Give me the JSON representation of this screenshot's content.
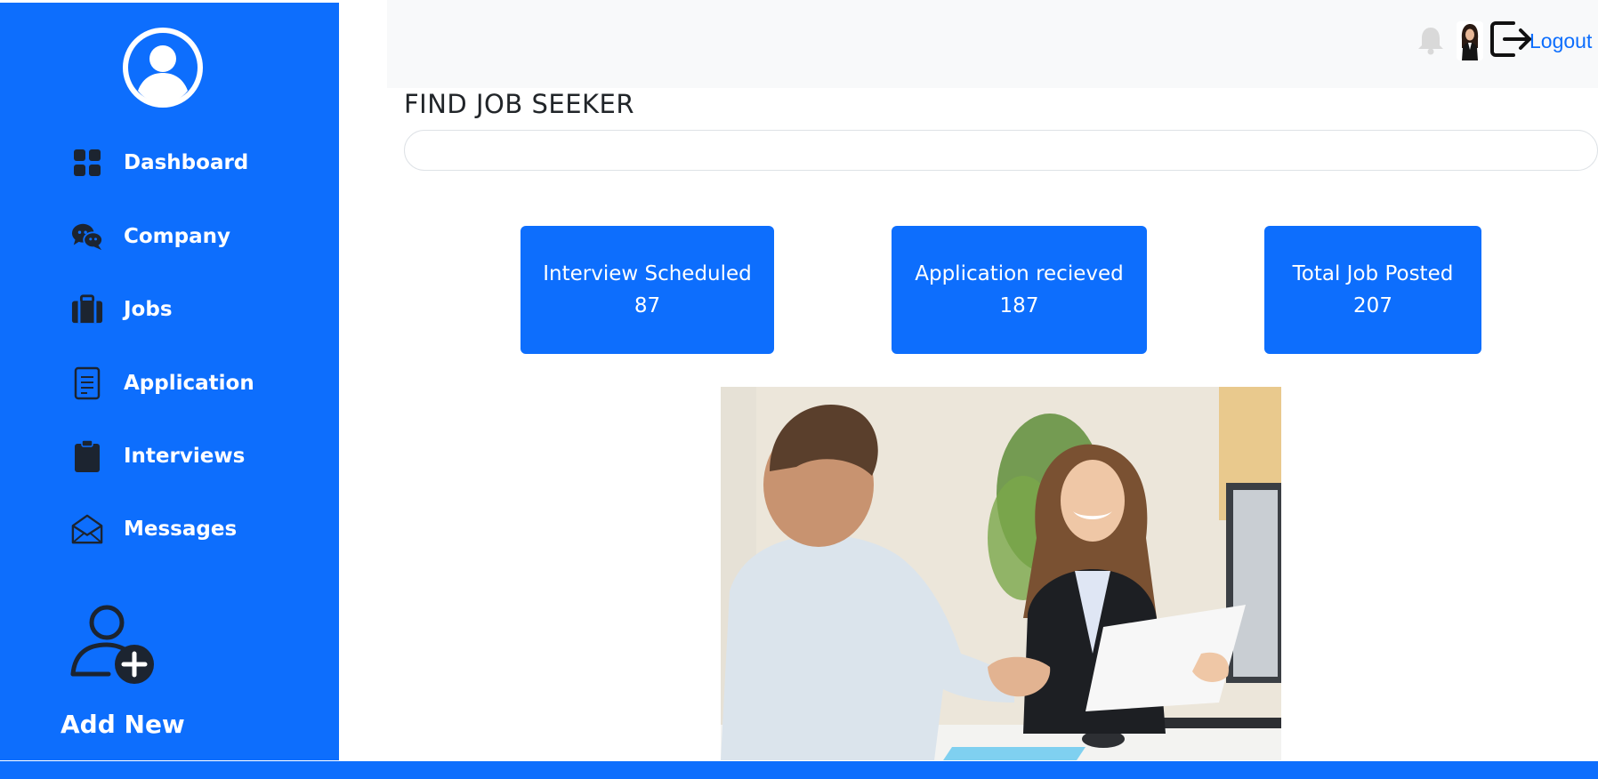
{
  "sidebar": {
    "items": [
      {
        "label": "Dashboard",
        "icon": "dashboard-grid-icon"
      },
      {
        "label": "Company",
        "icon": "chat-bubbles-icon"
      },
      {
        "label": "Jobs",
        "icon": "briefcase-icon"
      },
      {
        "label": "Application",
        "icon": "document-icon"
      },
      {
        "label": "Interviews",
        "icon": "clipboard-icon"
      },
      {
        "label": "Messages",
        "icon": "envelope-icon"
      }
    ],
    "add_new_label": "Add New"
  },
  "topbar": {
    "logout_label": "Logout"
  },
  "main": {
    "title": "FIND JOB SEEKER",
    "search_value": "",
    "stats": [
      {
        "label": "Interview Scheduled",
        "value": "87"
      },
      {
        "label": "Application recieved",
        "value": "187"
      },
      {
        "label": "Total Job Posted",
        "value": "207"
      }
    ]
  },
  "colors": {
    "primary": "#0d6efd",
    "topbar_bg": "#f8f9fa",
    "icon_dark": "#1c2430"
  }
}
